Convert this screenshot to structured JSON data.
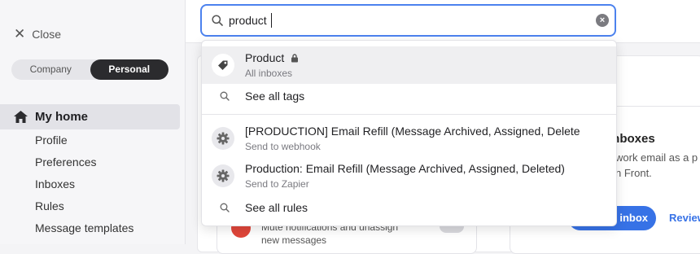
{
  "sidebar": {
    "close_label": "Close",
    "segments": [
      "Company",
      "Personal"
    ],
    "active_segment": "Personal",
    "home_label": "My home",
    "items": [
      "Profile",
      "Preferences",
      "Inboxes",
      "Rules",
      "Message templates"
    ]
  },
  "search": {
    "value": "product"
  },
  "dropdown": {
    "tag_result": {
      "title": "Product",
      "subtitle": "All inboxes",
      "icon": "tag-icon",
      "locked": true
    },
    "see_all_tags": "See all tags",
    "rule_results": [
      {
        "title": "[PRODUCTION] Email Refill (Message Archived, Assigned, Delete",
        "subtitle": "Send to webhook",
        "icon": "gear-icon"
      },
      {
        "title": "Production: Email Refill (Message Archived, Assigned, Deleted)",
        "subtitle": "Send to Zapier",
        "icon": "gear-icon"
      }
    ],
    "see_all_rules": "See all rules"
  },
  "background": {
    "card_title": "inboxes",
    "card_text_1": "work email as a p",
    "card_text_2": "n Front.",
    "button_label": "inbox",
    "link_label": "Review",
    "mute_text_1": "Mute notifications and unassign",
    "mute_text_2": "new messages"
  },
  "colors": {
    "accent": "#4c82ee",
    "primary_button": "#3772e6",
    "active_segment": "#2b2b2e"
  }
}
